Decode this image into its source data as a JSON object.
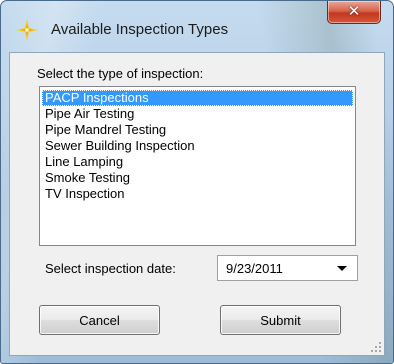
{
  "window": {
    "title": "Available Inspection Types",
    "close_icon": "close-icon",
    "app_icon": "sparkle-icon"
  },
  "form": {
    "prompt": "Select the type of inspection:",
    "items": [
      "PACP Inspections",
      "Pipe Air Testing",
      "Pipe Mandrel Testing",
      "Sewer Building Inspection",
      "Line Lamping",
      "Smoke Testing",
      "TV Inspection"
    ],
    "selected_item": "PACP Inspections",
    "date_label": "Select inspection date:",
    "date_value": "9/23/2011",
    "cancel_label": "Cancel",
    "submit_label": "Submit"
  },
  "colors": {
    "selection": "#3399ff",
    "close_button": "#c2381f",
    "icon_yellow": "#e8d200",
    "icon_orange": "#f08a1c"
  }
}
